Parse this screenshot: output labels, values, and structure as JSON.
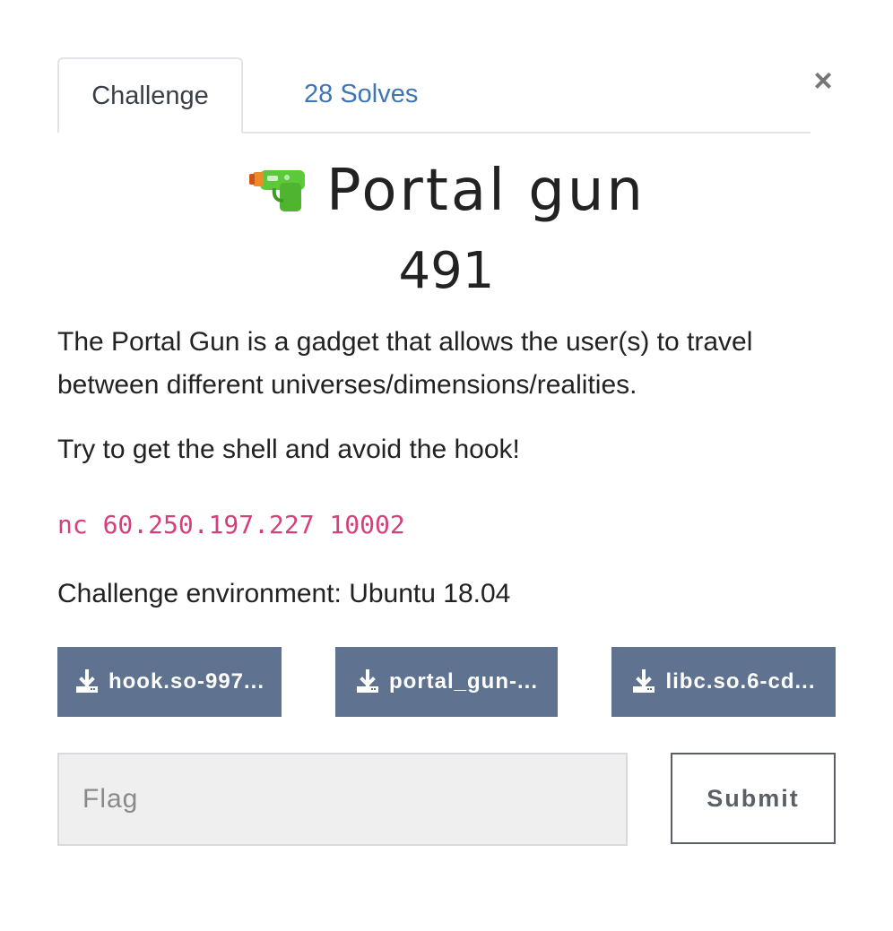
{
  "tabs": {
    "challenge_label": "Challenge",
    "solves_label": "28 Solves"
  },
  "close_label": "×",
  "challenge": {
    "emoji_icon": "water-pistol-icon",
    "name": "Portal gun",
    "value": "491",
    "description": "The Portal Gun is a gadget that allows the user(s) to travel between different universes/dimensions/realities.",
    "hint": "Try to get the shell and avoid the hook!",
    "connection": "nc 60.250.197.227 10002",
    "environment": "Challenge environment: Ubuntu 18.04"
  },
  "files": [
    {
      "label": "hook.so-997...",
      "icon": "download-icon"
    },
    {
      "label": "portal_gun-...",
      "icon": "download-icon"
    },
    {
      "label": "libc.so.6-cd...",
      "icon": "download-icon"
    }
  ],
  "form": {
    "flag_placeholder": "Flag",
    "flag_value": "",
    "submit_label": "Submit"
  },
  "colors": {
    "tab_link": "#3e75b5",
    "file_button": "#5f7391",
    "code_text": "#d63f7b"
  }
}
